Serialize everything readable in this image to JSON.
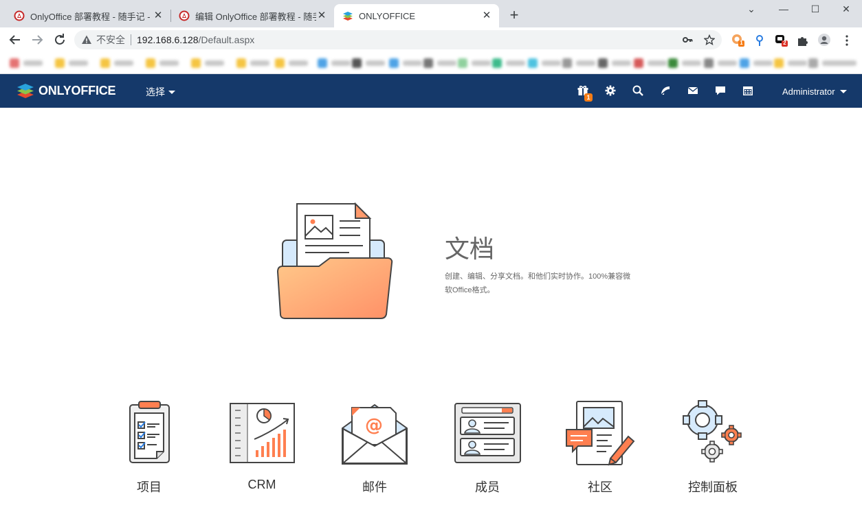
{
  "browser": {
    "tabs": [
      {
        "title": "OnlyOffice 部署教程 - 随手记 -",
        "active": false
      },
      {
        "title": "编辑 OnlyOffice 部署教程 - 随手",
        "active": false
      },
      {
        "title": "ONLYOFFICE",
        "active": true
      }
    ],
    "security_label": "不安全",
    "url_host": "192.168.6.128",
    "url_path": "/Default.aspx",
    "extension_badges": {
      "ext1": "1",
      "ext3": "2"
    }
  },
  "appbar": {
    "logo": "ONLYOFFICE",
    "selector_label": "选择",
    "notification_count": "1",
    "user_name": "Administrator"
  },
  "hero": {
    "title": "文档",
    "description": "创建、编辑、分享文档。和他们实时协作。100%兼容微软Office格式。"
  },
  "modules": [
    {
      "label": "项目",
      "icon": "projects-icon"
    },
    {
      "label": "CRM",
      "icon": "crm-icon"
    },
    {
      "label": "邮件",
      "icon": "mail-icon"
    },
    {
      "label": "成员",
      "icon": "people-icon"
    },
    {
      "label": "社区",
      "icon": "community-icon"
    },
    {
      "label": "控制面板",
      "icon": "control-panel-icon"
    }
  ],
  "colors": {
    "appbar": "#15396a",
    "accent": "#f57c16",
    "tabstrip": "#dee1e6"
  }
}
